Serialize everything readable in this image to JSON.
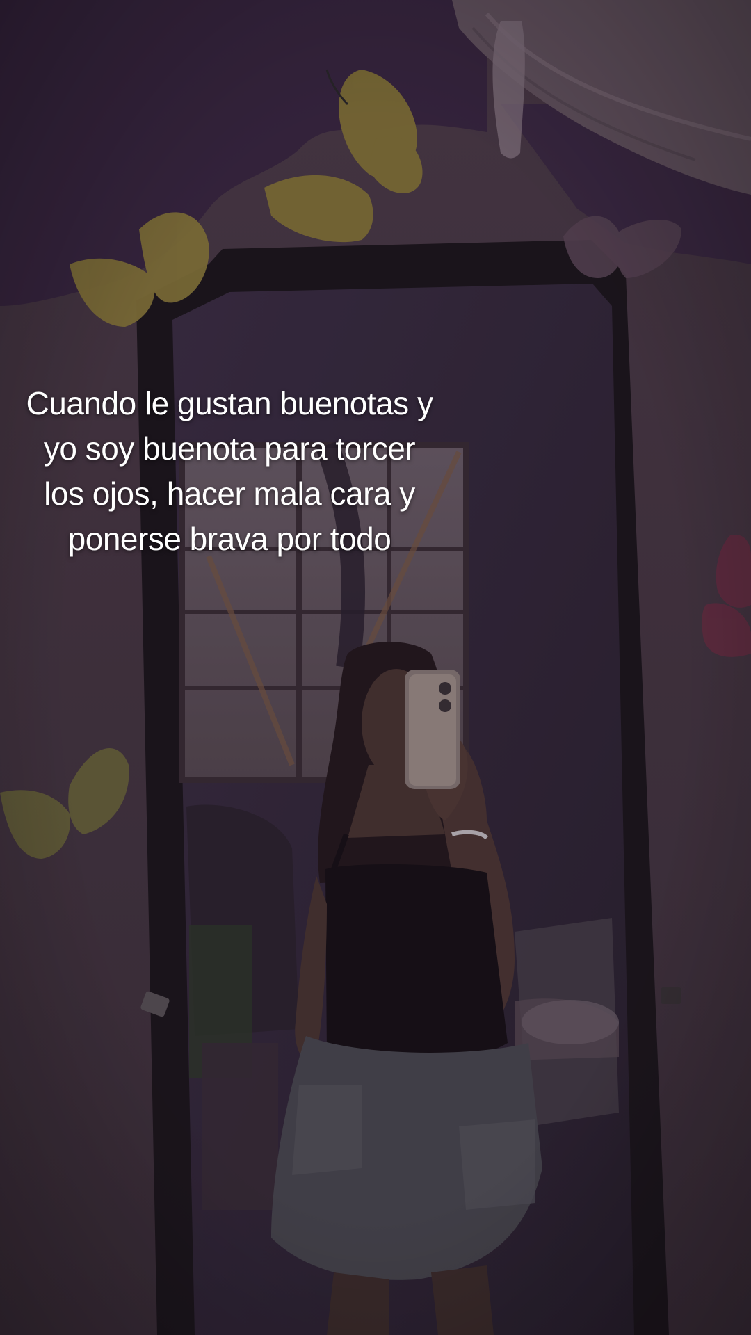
{
  "caption": {
    "lines": [
      "Cuando le gustan buenotas y",
      "yo soy buenota para torcer",
      "los ojos, hacer mala cara y",
      "ponerse brava por todo"
    ]
  },
  "colors": {
    "wall_purple": "#3d2a45",
    "wall_pink": "#4f3f4c",
    "mirror_frame": "#1f1a20",
    "mirror_glass": "#3a2f40",
    "butterfly_gold": "#8a7a3a",
    "butterfly_pink": "#6a3046",
    "caption_text": "#ffffff"
  }
}
